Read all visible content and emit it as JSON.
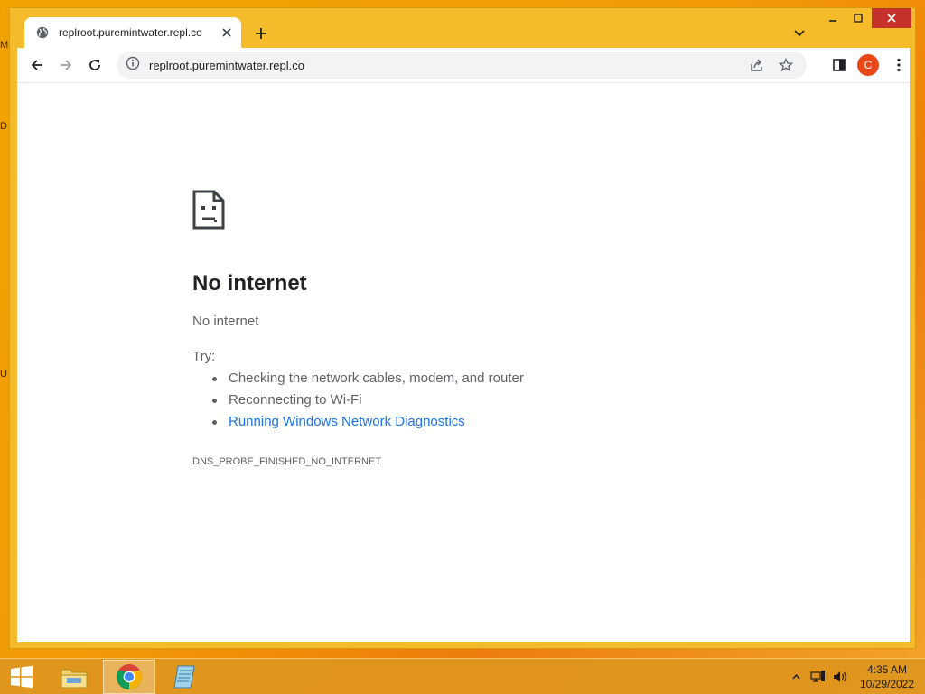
{
  "desktop": {
    "glyphs": [
      "M",
      "D",
      "U"
    ]
  },
  "browser": {
    "tab": {
      "title": "replroot.puremintwater.repl.co",
      "favicon": "globe-icon"
    },
    "url": "replroot.puremintwater.repl.co",
    "profile_initial": "C",
    "accent_color": "#1a73e8",
    "profile_color": "#e8481a"
  },
  "error_page": {
    "title": "No internet",
    "subtitle": "No internet",
    "try_label": "Try:",
    "suggestions": [
      "Checking the network cables, modem, and router",
      "Reconnecting to Wi-Fi",
      "Running Windows Network Diagnostics"
    ],
    "error_code": "DNS_PROBE_FINISHED_NO_INTERNET"
  },
  "taskbar": {
    "time": "4:35 AM",
    "date": "10/29/2022"
  }
}
